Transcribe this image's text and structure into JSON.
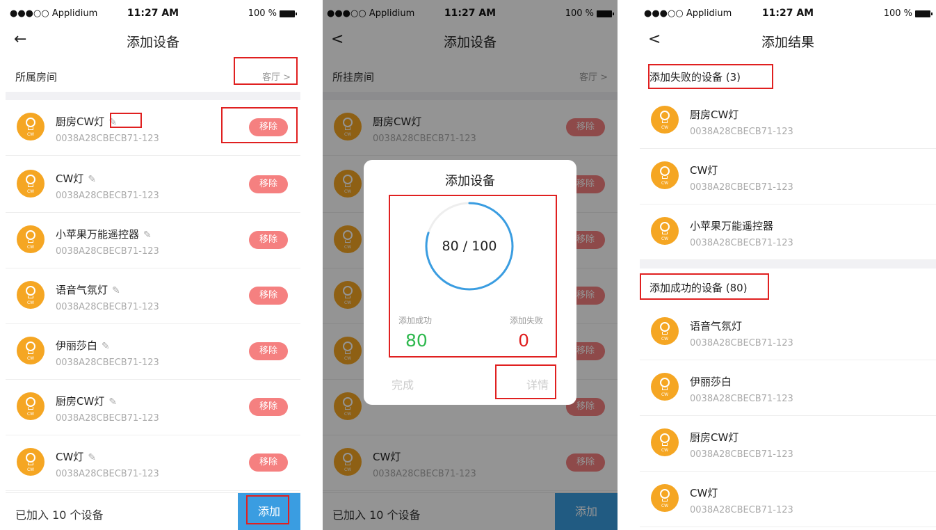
{
  "status": {
    "carrier": "●●●○○ Applidium",
    "time": "11:27 AM",
    "battery": "100 %"
  },
  "screen1": {
    "back_glyph": "←",
    "title": "添加设备",
    "room_label": "所属房间",
    "room_value": "客厅  >",
    "remove_label": "移除",
    "edit_glyph": "✎",
    "devices": [
      {
        "name": "厨房CW灯",
        "id": "0038A28CBECB71-123"
      },
      {
        "name": "CW灯",
        "id": "0038A28CBECB71-123"
      },
      {
        "name": "小苹果万能遥控器",
        "id": "0038A28CBECB71-123"
      },
      {
        "name": "语音气氛灯",
        "id": "0038A28CBECB71-123"
      },
      {
        "name": "伊丽莎白",
        "id": "0038A28CBECB71-123"
      },
      {
        "name": "厨房CW灯",
        "id": "0038A28CBECB71-123"
      },
      {
        "name": "CW灯",
        "id": "0038A28CBECB71-123"
      }
    ],
    "footer_text": "已加入 10 个设备",
    "add_label": "添加"
  },
  "screen2": {
    "back_glyph": "<",
    "title": "添加设备",
    "room_label": "所挂房间",
    "room_value": "客厅  >",
    "remove_label": "移除",
    "devices": [
      {
        "name": "厨房CW灯",
        "id": "0038A28CBECB71-123"
      },
      {
        "name": "CW灯",
        "id": "0038A28CBECB71-123"
      }
    ],
    "footer_text": "已加入 10 个设备",
    "add_label": "添加",
    "dialog": {
      "title": "添加设备",
      "progress_text": "80 / 100",
      "progress": 0.8,
      "success_label": "添加成功",
      "success_value": "80",
      "fail_label": "添加失败",
      "fail_value": "0",
      "done_label": "完成",
      "detail_label": "详情"
    }
  },
  "screen3": {
    "back_glyph": "<",
    "title": "添加结果",
    "failed_title": "添加失败的设备 (3)",
    "failed_devices": [
      {
        "name": "厨房CW灯",
        "id": "0038A28CBECB71-123"
      },
      {
        "name": "CW灯",
        "id": "0038A28CBECB71-123"
      },
      {
        "name": "小苹果万能遥控器",
        "id": "0038A28CBECB71-123"
      }
    ],
    "success_title": "添加成功的设备 (80)",
    "success_devices": [
      {
        "name": "语音气氛灯",
        "id": "0038A28CBECB71-123"
      },
      {
        "name": "伊丽莎白",
        "id": "0038A28CBECB71-123"
      },
      {
        "name": "厨房CW灯",
        "id": "0038A28CBECB71-123"
      },
      {
        "name": "CW灯",
        "id": "0038A28CBECB71-123"
      }
    ]
  },
  "icon_badge": "CW",
  "colors": {
    "accent": "#3a9de1",
    "device_icon": "#f5a623",
    "remove_button": "#f58080",
    "success": "#2db84d",
    "fail": "#e02020",
    "highlight_box": "#e02020"
  }
}
